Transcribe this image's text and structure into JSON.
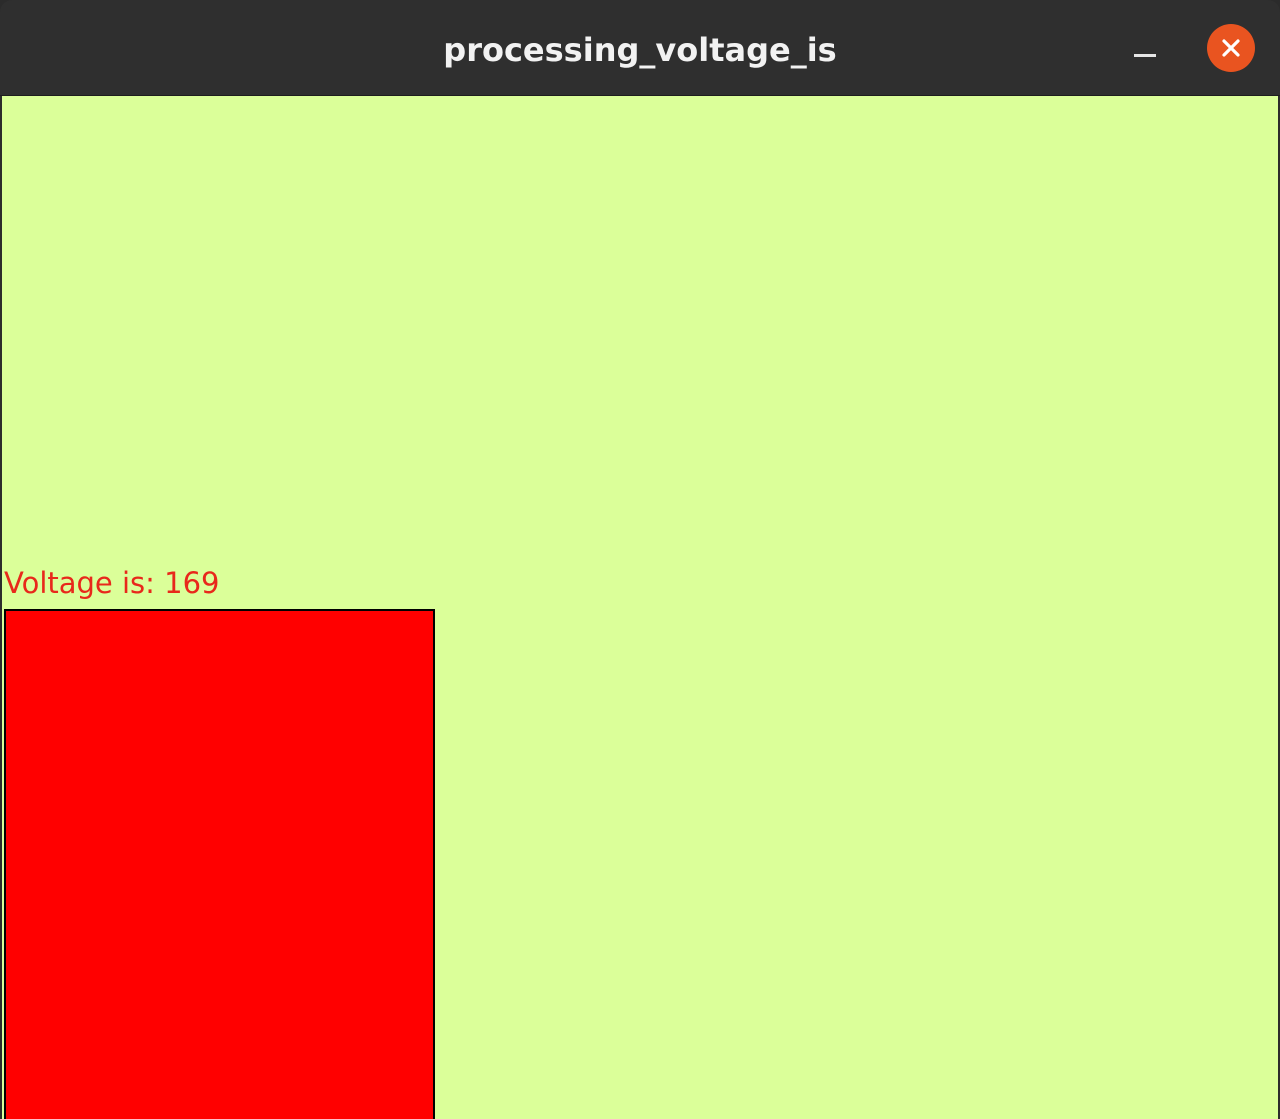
{
  "window": {
    "title": "processing_voltage_is"
  },
  "canvas": {
    "background_color": "#dbff99",
    "voltage_text": "Voltage is: 169",
    "voltage_value": 169,
    "bar_color": "#ff0000",
    "text_color": "#e8281b"
  },
  "icons": {
    "minimize": "minimize-icon",
    "close": "close-icon"
  }
}
